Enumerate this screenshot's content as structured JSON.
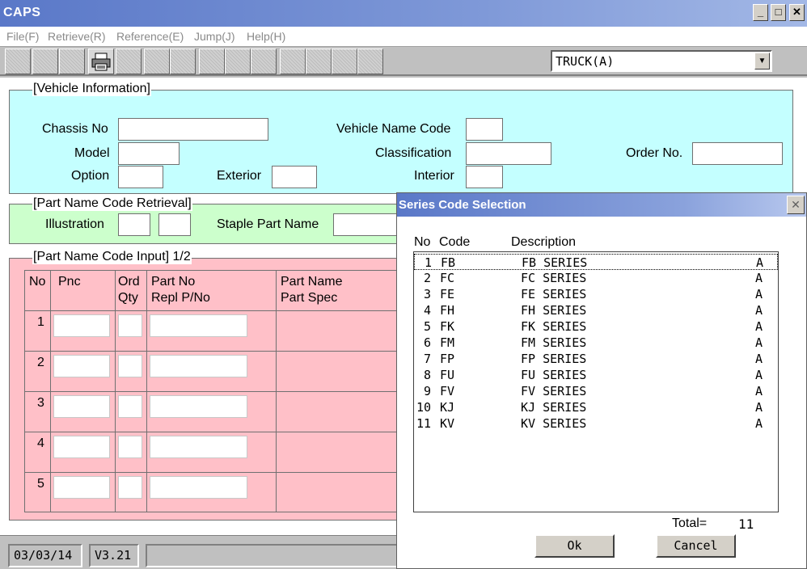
{
  "app": {
    "title": "CAPS"
  },
  "window_controls": {
    "minimize": "_",
    "maximize": "□",
    "close": "✕"
  },
  "menu": [
    "File(F)",
    "Retrieve(R)",
    "Reference(E)",
    "Jump(J)",
    "Help(H)"
  ],
  "toolbar": {
    "icons": [
      "blank-button",
      "blank-button",
      "blank-button",
      "printer-icon",
      "blank-button",
      "blank-button",
      "blank-button",
      "blank-button",
      "blank-button",
      "blank-button",
      "blank-button",
      "blank-button",
      "blank-button",
      "blank-button"
    ],
    "combo_value": "TRUCK(A)",
    "combo_arrow": "▼"
  },
  "vehicle": {
    "title": "[Vehicle Information]",
    "chassis_label": "Chassis No",
    "model_label": "Model",
    "option_label": "Option",
    "exterior_label": "Exterior",
    "vname_label": "Vehicle Name Code",
    "class_label": "Classification",
    "interior_label": "Interior",
    "order_label": "Order No.",
    "color": "#c4ffff"
  },
  "retrieval": {
    "title": "[Part Name Code Retrieval]",
    "illustration_label": "Illustration",
    "staple_label": "Staple Part Name",
    "color": "#ccffcc"
  },
  "input": {
    "title": "[Part Name Code Input] 1/2",
    "headers": {
      "no": "No",
      "pnc": "Pnc",
      "ord": "Ord",
      "qty": "Qty",
      "partno": "Part No",
      "repl": "Repl P/No",
      "pname": "Part Name",
      "pspec": "Part Spec"
    },
    "rows": [
      "1",
      "2",
      "3",
      "4",
      "5"
    ],
    "color": "#ffc0c8"
  },
  "status": {
    "date": "03/03/14",
    "version": "V3.21"
  },
  "dialog": {
    "title": "Series Code Selection",
    "close": "✕",
    "headers": {
      "no": "No",
      "code": "Code",
      "desc": "Description"
    },
    "items": [
      {
        "no": "1",
        "code": "FB",
        "desc": "FB SERIES",
        "flag": "A"
      },
      {
        "no": "2",
        "code": "FC",
        "desc": "FC SERIES",
        "flag": "A"
      },
      {
        "no": "3",
        "code": "FE",
        "desc": "FE SERIES",
        "flag": "A"
      },
      {
        "no": "4",
        "code": "FH",
        "desc": "FH SERIES",
        "flag": "A"
      },
      {
        "no": "5",
        "code": "FK",
        "desc": "FK SERIES",
        "flag": "A"
      },
      {
        "no": "6",
        "code": "FM",
        "desc": "FM SERIES",
        "flag": "A"
      },
      {
        "no": "7",
        "code": "FP",
        "desc": "FP SERIES",
        "flag": "A"
      },
      {
        "no": "8",
        "code": "FU",
        "desc": "FU SERIES",
        "flag": "A"
      },
      {
        "no": "9",
        "code": "FV",
        "desc": "FV SERIES",
        "flag": "A"
      },
      {
        "no": "10",
        "code": "KJ",
        "desc": "KJ SERIES",
        "flag": "A"
      },
      {
        "no": "11",
        "code": "KV",
        "desc": "KV SERIES",
        "flag": "A"
      }
    ],
    "total_label": "Total=",
    "total_value": "11",
    "ok_label": "Ok",
    "cancel_label": "Cancel"
  }
}
